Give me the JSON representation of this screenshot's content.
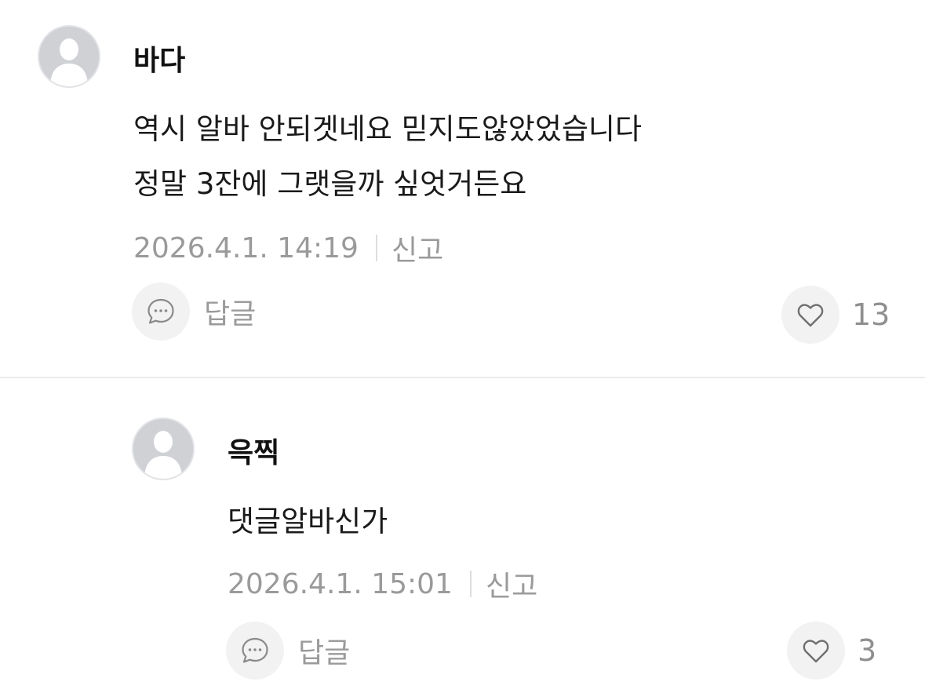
{
  "comments": [
    {
      "author": "바다",
      "text": "역시 알바 안되겟네요 믿지도않았었습니다\n정말 3잔에 그랫을까 싶엇거든요",
      "date": "2026.4.1. 14:19",
      "report_label": "신고",
      "reply_label": "답글",
      "likes": "13"
    },
    {
      "author": "윽찍",
      "text": "댓글알바신가",
      "date": "2026.4.1. 15:01",
      "report_label": "신고",
      "reply_label": "답글",
      "likes": "3"
    }
  ],
  "icons": {
    "avatar": "default-user-silhouette-icon",
    "reply": "speech-bubble-icon",
    "like": "heart-outline-icon"
  },
  "colors": {
    "meta_text": "#9a9a9a",
    "avatar_bg": "#cfd1d5",
    "button_bg": "#f2f2f3"
  }
}
